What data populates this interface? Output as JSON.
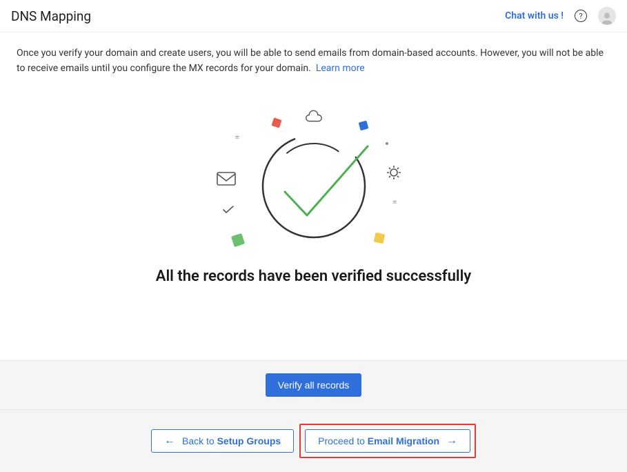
{
  "header": {
    "title": "DNS Mapping",
    "chat": "Chat with us !"
  },
  "description": {
    "text": "Once you verify your domain and create users, you will be able to send emails from domain-based accounts. However, you will not be able to receive emails until you configure the MX records for your domain.",
    "learn_more": "Learn more"
  },
  "success": {
    "heading": "All the records have been verified successfully"
  },
  "footer": {
    "verify": "Verify all records",
    "back_prefix": "Back to ",
    "back_strong": "Setup Groups",
    "proceed_prefix": "Proceed to ",
    "proceed_strong": "Email Migration"
  }
}
